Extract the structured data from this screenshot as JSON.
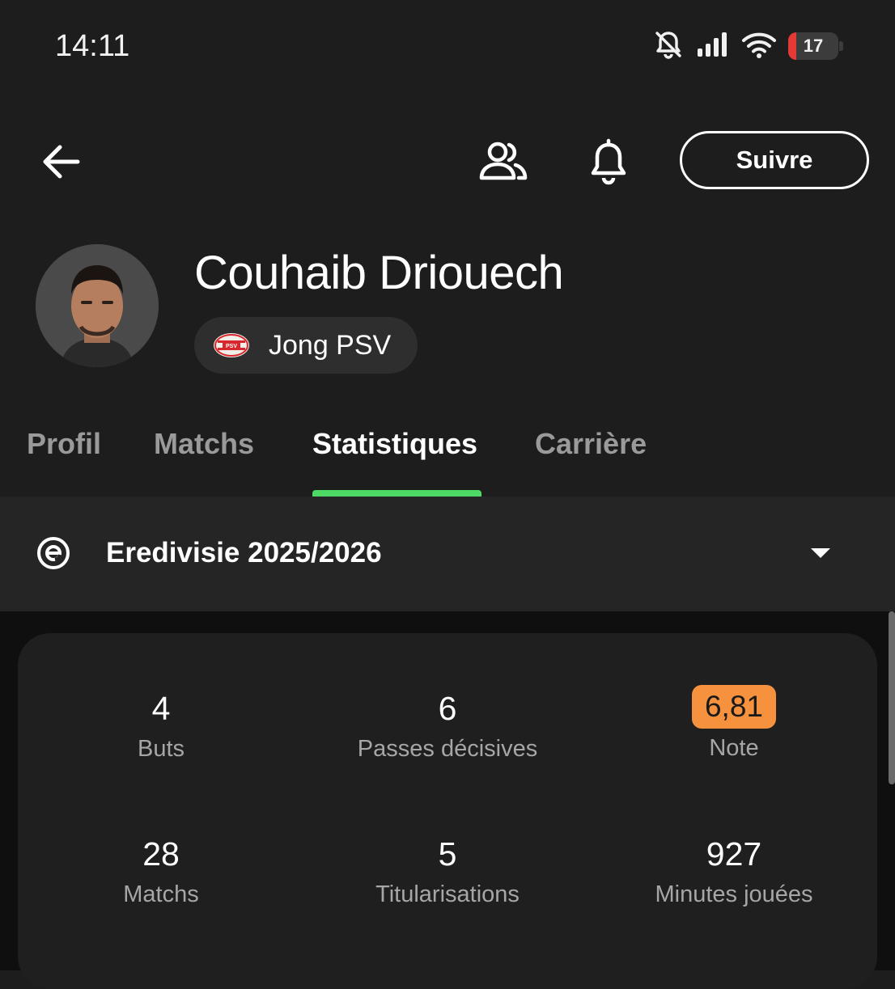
{
  "status_bar": {
    "time": "14:11",
    "battery_level": "17",
    "icons": [
      "bell-off-icon",
      "signal-icon",
      "wifi-icon",
      "battery-icon"
    ]
  },
  "header": {
    "follow_label": "Suivre",
    "icons": [
      "back-arrow-icon",
      "people-icon",
      "bell-icon"
    ]
  },
  "player": {
    "name": "Couhaib Driouech",
    "team": "Jong PSV"
  },
  "tabs": [
    {
      "label": "Profil",
      "active": false
    },
    {
      "label": "Matchs",
      "active": false
    },
    {
      "label": "Statistiques",
      "active": true
    },
    {
      "label": "Carrière",
      "active": false
    }
  ],
  "league": {
    "name": "Eredivisie 2025/2026",
    "icon": "eredivisie-logo-icon"
  },
  "stats": [
    {
      "value": "4",
      "label": "Buts"
    },
    {
      "value": "6",
      "label": "Passes décisives"
    },
    {
      "value": "6,81",
      "label": "Note"
    },
    {
      "value": "28",
      "label": "Matchs"
    },
    {
      "value": "5",
      "label": "Titularisations"
    },
    {
      "value": "927",
      "label": "Minutes jouées"
    }
  ],
  "colors": {
    "accent_tab": "#4cd964",
    "rating_badge": "#f6913e",
    "battery_low": "#e53935"
  }
}
